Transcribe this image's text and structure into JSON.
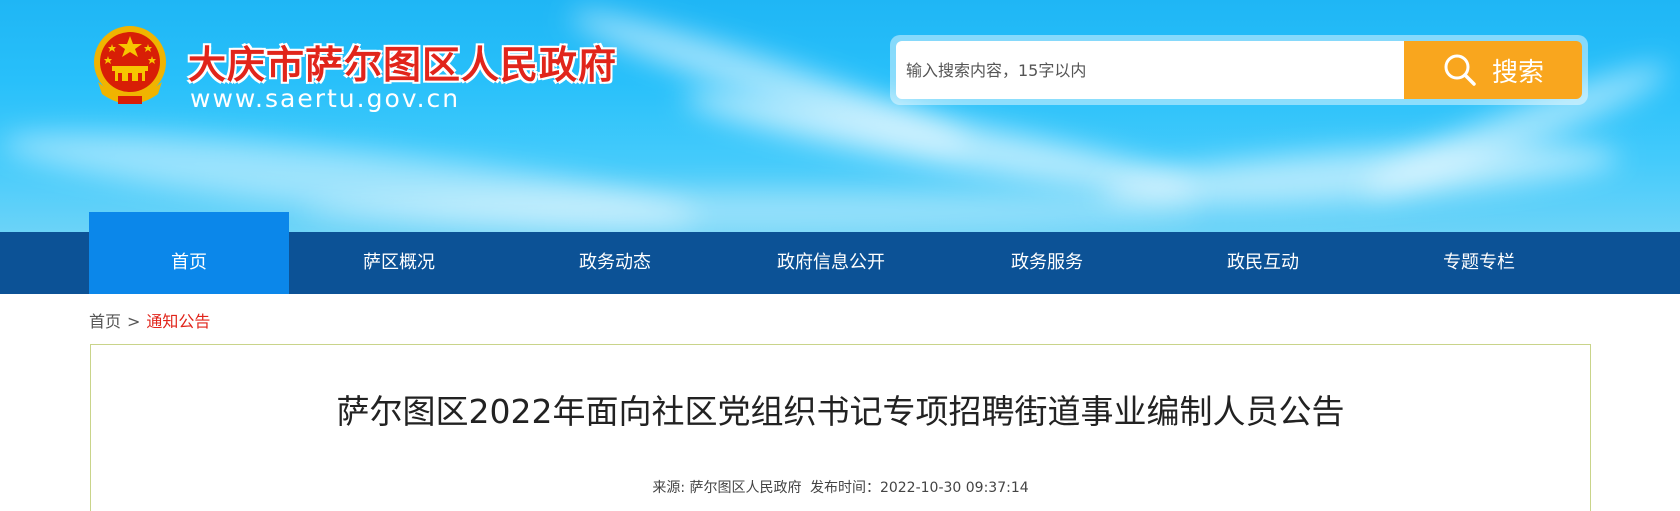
{
  "header": {
    "site_title": "大庆市萨尔图区人民政府",
    "site_url": "www.saertu.gov.cn",
    "emblem_icon": "national-emblem-icon"
  },
  "search": {
    "placeholder": "输入搜索内容，15字以内",
    "button_label": "搜索",
    "button_icon": "search-icon",
    "button_color": "#f9a61e"
  },
  "nav": {
    "items": [
      {
        "label": "首页",
        "active": true
      },
      {
        "label": "萨区概况"
      },
      {
        "label": "政务动态"
      },
      {
        "label": "政府信息公开"
      },
      {
        "label": "政务服务"
      },
      {
        "label": "政民互动"
      },
      {
        "label": "专题专栏"
      }
    ],
    "bar_color": "#0c5296",
    "active_color": "#0b87ea"
  },
  "breadcrumb": {
    "home": "首页",
    "separator": ">",
    "current": "通知公告"
  },
  "article": {
    "title": "萨尔图区2022年面向社区党组织书记专项招聘街道事业编制人员公告",
    "source_label": "来源:",
    "source_value": "萨尔图区人民政府",
    "time_label": "发布时间：",
    "time_value": "2022-10-30 09:37:14"
  }
}
